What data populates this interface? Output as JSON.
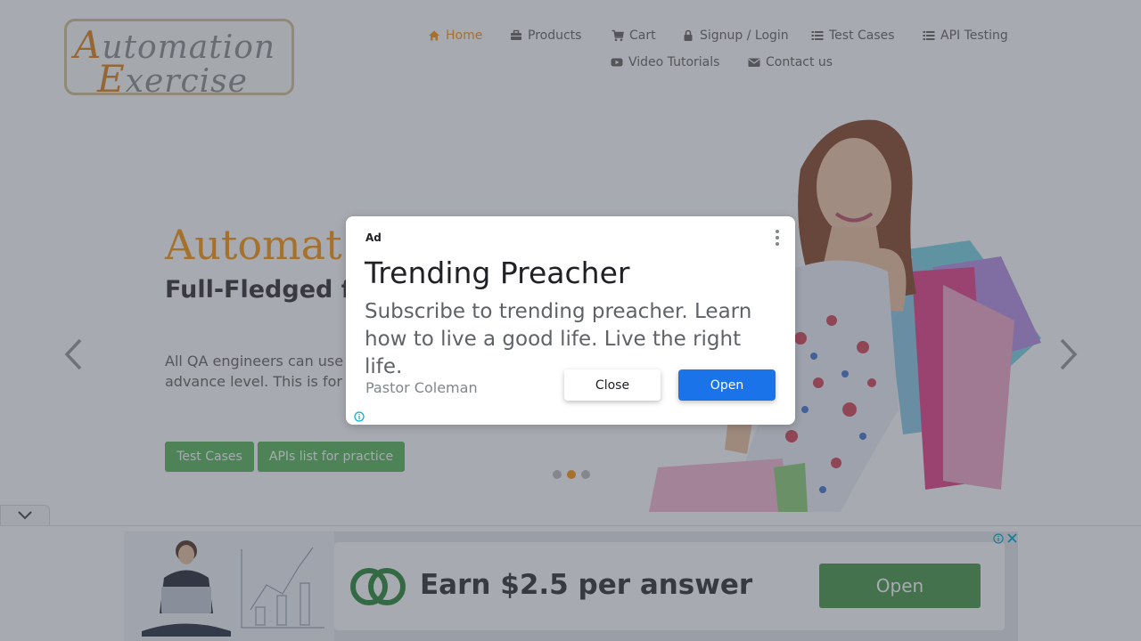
{
  "header": {
    "logo": {
      "line1_cap": "A",
      "line1_rest": "utomation",
      "line2_cap": "E",
      "line2_rest": "xercise"
    },
    "nav": [
      {
        "label": "Home",
        "icon": "home-icon",
        "active": true
      },
      {
        "label": "Products",
        "icon": "briefcase-icon",
        "active": false
      },
      {
        "label": "Cart",
        "icon": "cart-icon",
        "active": false
      },
      {
        "label": "Signup / Login",
        "icon": "lock-icon",
        "active": false
      },
      {
        "label": "Test Cases",
        "icon": "list-icon",
        "active": false
      },
      {
        "label": "API Testing",
        "icon": "list-icon",
        "active": false
      },
      {
        "label": "Video Tutorials",
        "icon": "youtube-icon",
        "active": false
      },
      {
        "label": "Contact us",
        "icon": "envelope-icon",
        "active": false
      }
    ]
  },
  "slider": {
    "title": "Automat",
    "subtitle": "Full-Fledged for Automatio",
    "description": "All QA engineers can use practice and API testing e advance level. This is for their automation skills.",
    "buttons": [
      "Test Cases",
      "APIs list for practice"
    ],
    "active_dot": 2,
    "dot_count": 3
  },
  "modal": {
    "ad_label": "Ad",
    "title": "Trending Preacher",
    "body": "Subscribe to trending preacher. Learn how to live a good life. Live the right life.",
    "advertiser": "Pastor Coleman",
    "close_label": "Close",
    "open_label": "Open"
  },
  "bottom_ad": {
    "headline": "Earn $2.5 per answer",
    "cta": "Open"
  },
  "colors": {
    "accent": "#fe980f",
    "green": "#5cb85c",
    "ad_blue": "#1a73e8",
    "ad_green": "#4c9a4a"
  }
}
